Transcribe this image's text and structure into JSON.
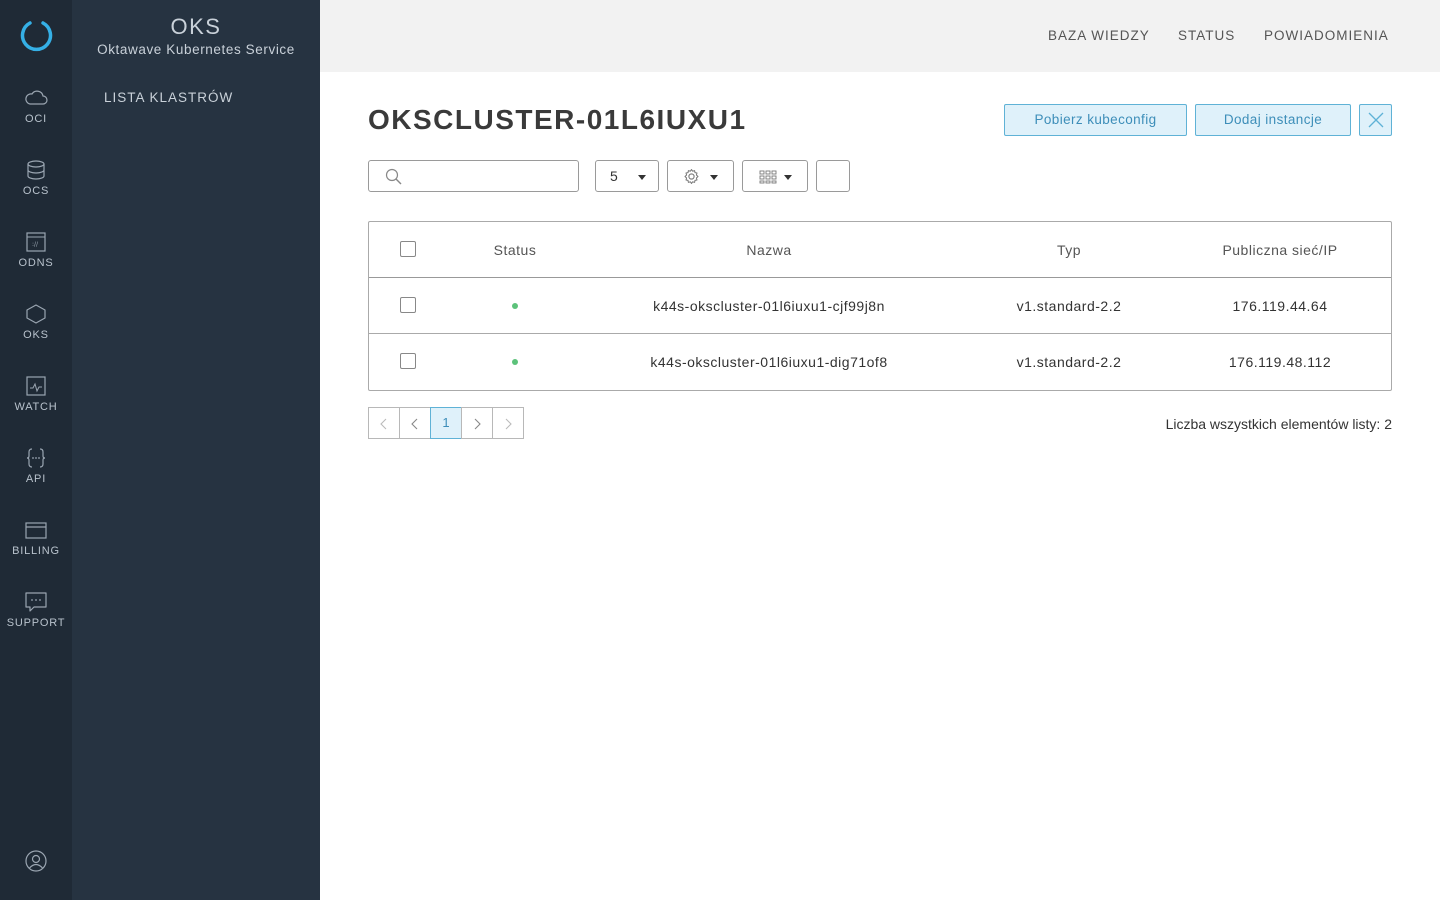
{
  "rail": {
    "items": [
      {
        "label": "OCI",
        "icon": "cloud-icon"
      },
      {
        "label": "OCS",
        "icon": "database-icon"
      },
      {
        "label": "ODNS",
        "icon": "dns-icon"
      },
      {
        "label": "OKS",
        "icon": "hexagon-icon"
      },
      {
        "label": "WATCH",
        "icon": "monitor-icon"
      },
      {
        "label": "API",
        "icon": "braces-icon"
      },
      {
        "label": "BILLING",
        "icon": "card-icon"
      },
      {
        "label": "SUPPORT",
        "icon": "chat-icon"
      }
    ]
  },
  "sidebar": {
    "title": "OKS",
    "subtitle": "Oktawave Kubernetes Service",
    "link": "LISTA KLASTRÓW"
  },
  "topnav": {
    "items": [
      "BAZA WIEDZY",
      "STATUS",
      "POWIADOMIENIA"
    ]
  },
  "main": {
    "title": "OKSCLUSTER-01L6IUXU1",
    "download_button": "Pobierz kubeconfig",
    "add_button": "Dodaj instancje",
    "page_size": "5",
    "search_placeholder": ""
  },
  "table": {
    "columns": [
      "Status",
      "Nazwa",
      "Typ",
      "Publiczna sieć/IP"
    ],
    "rows": [
      {
        "status": "active",
        "name": "k44s-okscluster-01l6iuxu1-cjf99j8n",
        "type": "v1.standard-2.2",
        "ip": "176.119.44.64"
      },
      {
        "status": "active",
        "name": "k44s-okscluster-01l6iuxu1-dig71of8",
        "type": "v1.standard-2.2",
        "ip": "176.119.48.112"
      }
    ]
  },
  "pagination": {
    "current_page": "1",
    "total_label": "Liczba wszystkich elementów listy: 2"
  },
  "colors": {
    "status_ok": "#5cc27a",
    "accent": "#5fb2d6",
    "rail_bg": "#1f2a36",
    "sidebar_bg": "#263341"
  }
}
